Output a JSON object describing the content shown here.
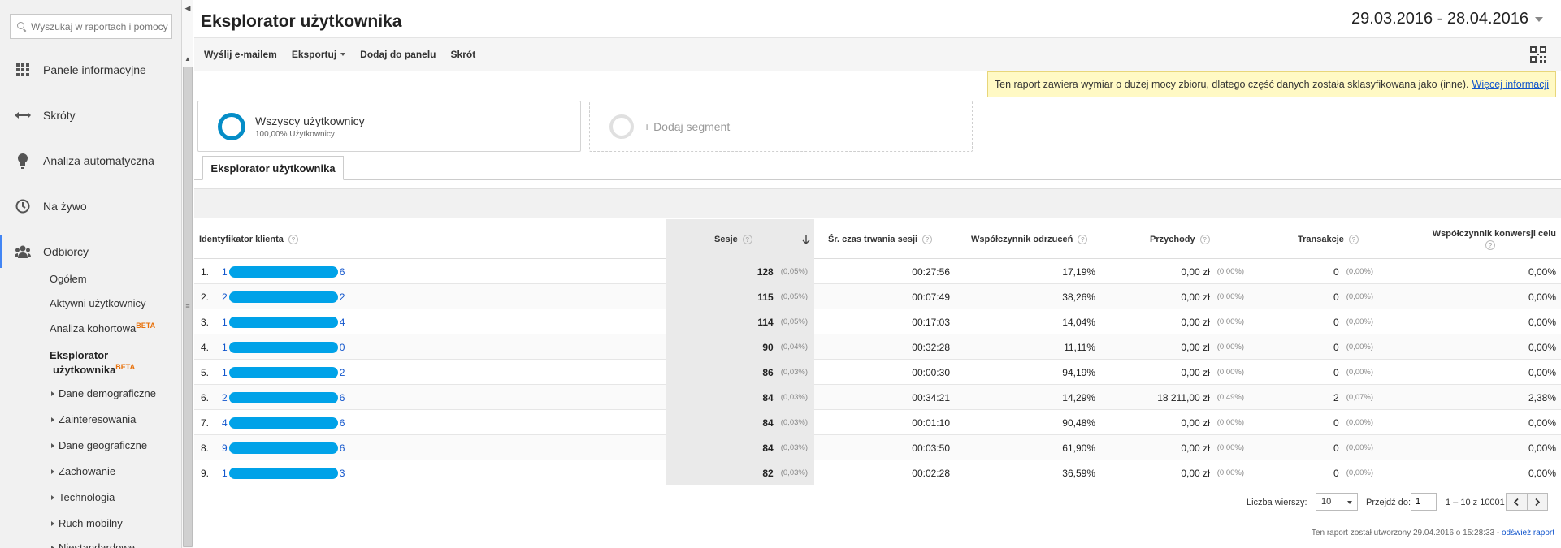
{
  "sidebar": {
    "search_placeholder": "Wyszukaj w raportach i pomocy",
    "nav": [
      {
        "label": "Panele informacyjne",
        "icon": "grid-icon"
      },
      {
        "label": "Skróty",
        "icon": "arrow-shortcut-icon"
      },
      {
        "label": "Analiza automatyczna",
        "icon": "lightbulb-icon"
      },
      {
        "label": "Na żywo",
        "icon": "clock-icon"
      },
      {
        "label": "Odbiorcy",
        "icon": "people-icon"
      }
    ],
    "audience_sub": {
      "overview": "Ogółem",
      "active_users": "Aktywni użytkownicy",
      "cohort": "Analiza kohortowa",
      "explorer_line1": "Eksplorator",
      "explorer_line2": "użytkownika",
      "beta": "BETA"
    },
    "audience_groups": [
      "Dane demograficzne",
      "Zainteresowania",
      "Dane geograficzne",
      "Zachowanie",
      "Technologia",
      "Ruch mobilny",
      "Niestandardowe"
    ]
  },
  "header": {
    "title": "Eksplorator użytkownika",
    "date_range": "29.03.2016 - 28.04.2016"
  },
  "toolbar": {
    "email": "Wyślij e-mailem",
    "export": "Eksportuj",
    "add_to_dashboard": "Dodaj do panelu",
    "shortcut": "Skrót"
  },
  "warning": {
    "text": "Ten raport zawiera wymiar o dużej mocy zbioru, dlatego część danych została sklasyfikowana jako (inne).",
    "link": "Więcej informacji"
  },
  "segments": {
    "all_users": "Wszyscy użytkownicy",
    "all_users_sub": "100,00% Użytkownicy",
    "add": "+ Dodaj segment"
  },
  "tab_label": "Eksplorator użytkownika",
  "table": {
    "headers": {
      "client_id": "Identyfikator klienta",
      "sessions": "Sesje",
      "avg_duration": "Śr. czas trwania sesji",
      "bounce_rate": "Współczynnik odrzuceń",
      "revenue": "Przychody",
      "transactions": "Transakcje",
      "conversion": "Współczynnik konwersji celu"
    },
    "rows": [
      {
        "idx": "1.",
        "id_start": "1",
        "id_end": "6",
        "sessions": "128",
        "sessions_pct": "(0,05%)",
        "duration": "00:27:56",
        "bounce": "17,19%",
        "revenue": "0,00 zł",
        "revenue_pct": "(0,00%)",
        "transactions": "0",
        "transactions_pct": "(0,00%)",
        "conversion": "0,00%"
      },
      {
        "idx": "2.",
        "id_start": "2",
        "id_end": "2",
        "sessions": "115",
        "sessions_pct": "(0,05%)",
        "duration": "00:07:49",
        "bounce": "38,26%",
        "revenue": "0,00 zł",
        "revenue_pct": "(0,00%)",
        "transactions": "0",
        "transactions_pct": "(0,00%)",
        "conversion": "0,00%"
      },
      {
        "idx": "3.",
        "id_start": "1",
        "id_end": "4",
        "sessions": "114",
        "sessions_pct": "(0,05%)",
        "duration": "00:17:03",
        "bounce": "14,04%",
        "revenue": "0,00 zł",
        "revenue_pct": "(0,00%)",
        "transactions": "0",
        "transactions_pct": "(0,00%)",
        "conversion": "0,00%"
      },
      {
        "idx": "4.",
        "id_start": "1",
        "id_end": "0",
        "sessions": "90",
        "sessions_pct": "(0,04%)",
        "duration": "00:32:28",
        "bounce": "11,11%",
        "revenue": "0,00 zł",
        "revenue_pct": "(0,00%)",
        "transactions": "0",
        "transactions_pct": "(0,00%)",
        "conversion": "0,00%"
      },
      {
        "idx": "5.",
        "id_start": "1",
        "id_end": "2",
        "sessions": "86",
        "sessions_pct": "(0,03%)",
        "duration": "00:00:30",
        "bounce": "94,19%",
        "revenue": "0,00 zł",
        "revenue_pct": "(0,00%)",
        "transactions": "0",
        "transactions_pct": "(0,00%)",
        "conversion": "0,00%"
      },
      {
        "idx": "6.",
        "id_start": "2",
        "id_end": "6",
        "sessions": "84",
        "sessions_pct": "(0,03%)",
        "duration": "00:34:21",
        "bounce": "14,29%",
        "revenue": "18 211,00 zł",
        "revenue_pct": "(0,49%)",
        "transactions": "2",
        "transactions_pct": "(0,07%)",
        "conversion": "2,38%"
      },
      {
        "idx": "7.",
        "id_start": "4",
        "id_end": "6",
        "sessions": "84",
        "sessions_pct": "(0,03%)",
        "duration": "00:01:10",
        "bounce": "90,48%",
        "revenue": "0,00 zł",
        "revenue_pct": "(0,00%)",
        "transactions": "0",
        "transactions_pct": "(0,00%)",
        "conversion": "0,00%"
      },
      {
        "idx": "8.",
        "id_start": "9",
        "id_end": "6",
        "sessions": "84",
        "sessions_pct": "(0,03%)",
        "duration": "00:03:50",
        "bounce": "61,90%",
        "revenue": "0,00 zł",
        "revenue_pct": "(0,00%)",
        "transactions": "0",
        "transactions_pct": "(0,00%)",
        "conversion": "0,00%"
      },
      {
        "idx": "9.",
        "id_start": "1",
        "id_end": "3",
        "sessions": "82",
        "sessions_pct": "(0,03%)",
        "duration": "00:02:28",
        "bounce": "36,59%",
        "revenue": "0,00 zł",
        "revenue_pct": "(0,00%)",
        "transactions": "0",
        "transactions_pct": "(0,00%)",
        "conversion": "0,00%"
      }
    ]
  },
  "pager": {
    "rows_label": "Liczba wierszy:",
    "rows_value": "10",
    "goto_label": "Przejdź do:",
    "goto_value": "1",
    "range": "1 – 10 z 10001"
  },
  "footer": {
    "text": "Ten raport został utworzony 29.04.2016 o 15:28:33 -",
    "refresh": "odśwież raport"
  },
  "colors": {
    "accent": "#4285f4",
    "segment_ring": "#058dc7",
    "redaction": "#00a2e8",
    "warning_bg": "#fff9c4",
    "link": "#1155cc"
  }
}
